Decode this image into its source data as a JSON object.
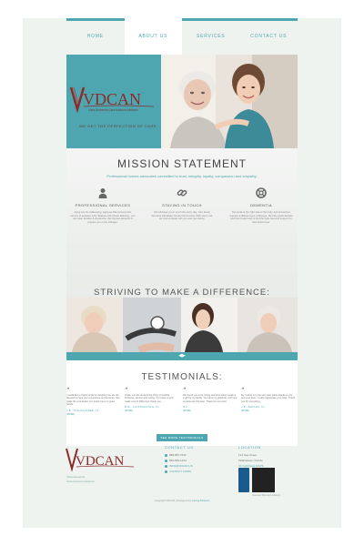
{
  "nav": {
    "items": [
      {
        "label": "HOME"
      },
      {
        "label": "ABOUT US"
      },
      {
        "label": "SERVICES"
      },
      {
        "label": "CONTACT US"
      }
    ]
  },
  "hero": {
    "logo_text": "VDCAN",
    "logo_tagline": "Vista Dementia Care Advisors Network",
    "tagline": "WE GET THE PERFECTION OF CARE"
  },
  "mission": {
    "title": "MISSION STATEMENT",
    "subtitle": "Professional homes advocates committed to trust, integrity, loyalty, compassion and empathy.",
    "features": [
      {
        "icon": "person-icon",
        "title": "PROFESSIONAL SERVICES",
        "desc": "Aging can be challenging, aging as little process that, service of assisted. Lifts, Balance with illness affecting , you can relay families & physicians, this the last elements & prepare you in the changes."
      },
      {
        "icon": "chain-link-icon",
        "title": "STAYING IN TOUCH",
        "desc": "We will keep you in touch the every day. Your family members will always be the first to know. With every visit, we communicate with you and your family."
      },
      {
        "icon": "lifebuoy-icon",
        "title": "DEMENTIA",
        "desc": "Dementia is the right side of the body, and sometimes requires a different type of lifestyle. We help guide families and their loved ones to find the right care and support for their loved ones."
      }
    ]
  },
  "striving": {
    "title": "STRIVING TO MAKE A DIFFERENCE:"
  },
  "slider": {
    "arrows": "◀▶"
  },
  "testimonials": {
    "title": "TESTIMONIALS:",
    "items": [
      {
        "text": "I would like to thank Linda for assisting me, we are blessed to have your experience and services. She made life a lot easier, our loved one is in good hands.",
        "who": "J.B., TALLAHASSEE, FL",
        "more": "[MORE]"
      },
      {
        "text": "Linda, you are all amazing thing, incredible, kindness, service and caring. You came in and made a lot of difference, thank you.",
        "who": "B.M., JACKSONVILLE, FL",
        "more": "[MORE]"
      },
      {
        "text": "We found you to be caring and kind. Every week is a gift for my family. You have my gratitude, and your services are the best. Thank you so much.",
        "who": "R.F.",
        "more": "[MORE]"
      },
      {
        "text": "My mother is in the very best place thanks to you and your team. I really appreciate your work. Thank you for everything.",
        "who": "J.B., NAPLES, FL",
        "more": "[MORE]"
      }
    ],
    "button_label": "SEE MORE TESTIMONIALS"
  },
  "footer": {
    "logo_text": "VDCAN",
    "left_lines": [
      "Vista Dementia",
      "Care Advisors Network"
    ],
    "contact_heading": "CONTACT US",
    "contact_lines": [
      "888-887-7632",
      "850-555-1234",
      "INFO@VDCAN.US",
      "CONTACT FORM"
    ],
    "location_heading": "LOCATION",
    "location_lines": [
      "123 Sea Street",
      "Tallahassee, Florida",
      "ON GOOGLE MAPS"
    ],
    "nnb_line": "Licensed Fiduciary Advisors"
  },
  "copyright": {
    "prefix": "Copyright VDCAN | Designed by ",
    "link": "Caring Advisors"
  },
  "colors": {
    "accent": "#4ea7b0",
    "logo": "#8b2b2b",
    "frame": "#eef3ef"
  }
}
